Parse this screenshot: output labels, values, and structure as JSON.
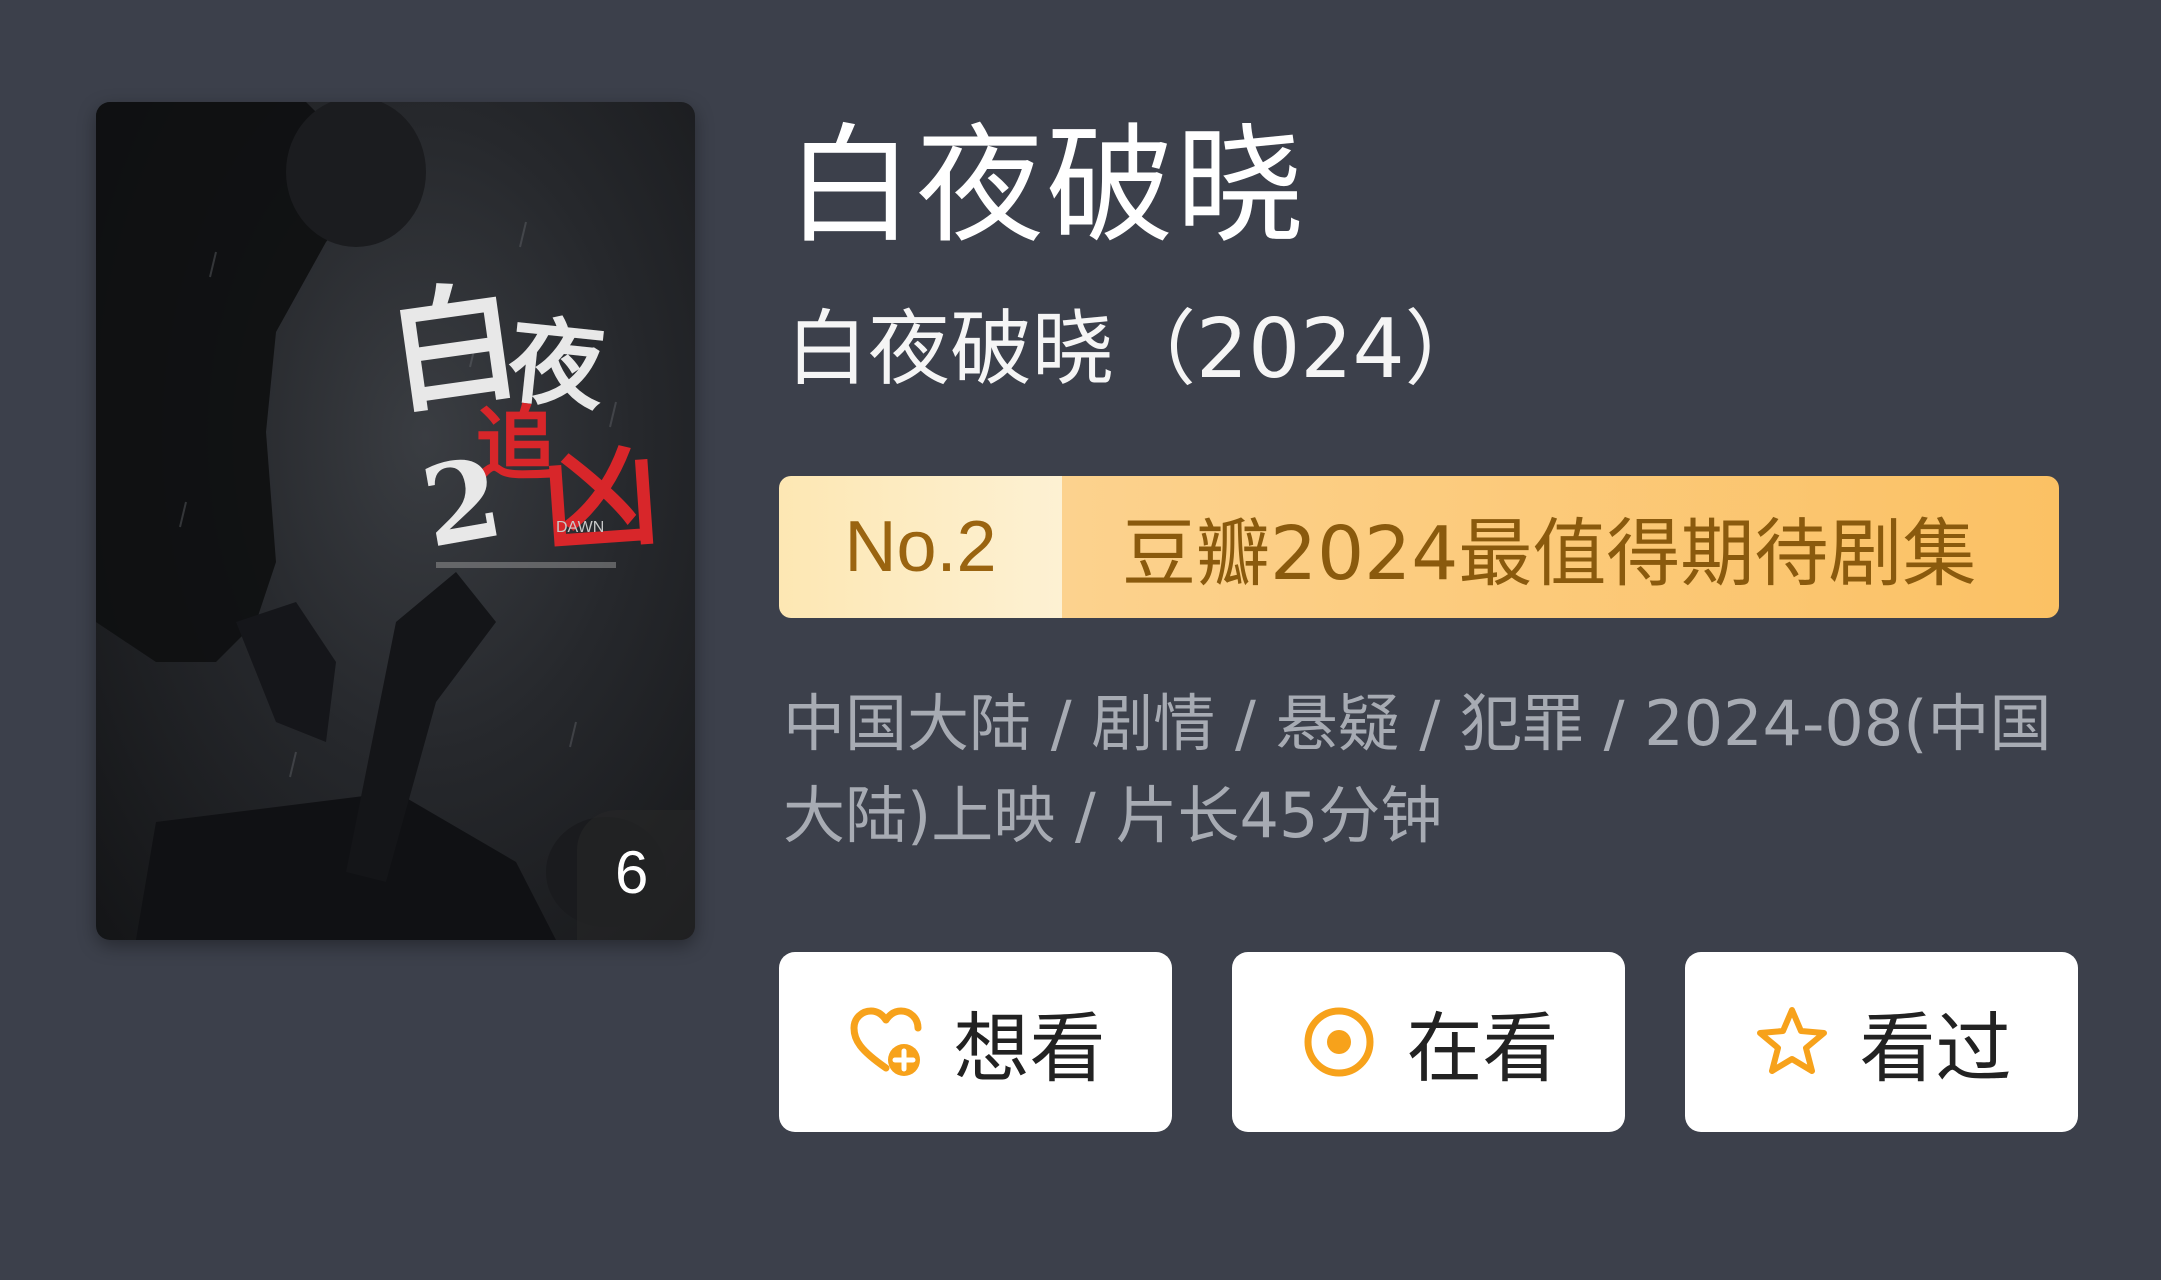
{
  "poster": {
    "title_art": "白夜追凶2",
    "episode_badge": "6"
  },
  "header": {
    "title": "白夜破晓",
    "subtitle": "白夜破晓（2024）"
  },
  "rank_banner": {
    "rank": "No.2",
    "text": "豆瓣2024最值得期待剧集",
    "colors": {
      "rank_bg": "#fde7b3",
      "text_bg": "#fbc164",
      "text_color": "#8a5a0d"
    }
  },
  "meta": {
    "line": "中国大陆 / 剧情 / 悬疑 / 犯罪 / 2024-08(中国大陆)上映 / 片长45分钟"
  },
  "actions": {
    "want": {
      "label": "想看",
      "icon": "heart-plus-icon"
    },
    "watching": {
      "label": "在看",
      "icon": "target-icon"
    },
    "watched": {
      "label": "看过",
      "icon": "star-icon"
    },
    "accent_color": "#f7a21b"
  }
}
